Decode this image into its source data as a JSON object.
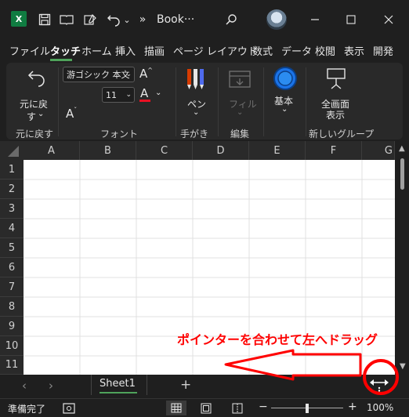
{
  "titlebar": {
    "app_badge": "X",
    "more": "»",
    "doc_title": "Book···"
  },
  "tabs": [
    "ファイル",
    "タッチ",
    "ホーム",
    "挿入",
    "描画",
    "ページ レイアウト",
    "数式",
    "データ",
    "校閲",
    "表示",
    "開発"
  ],
  "ribbon": {
    "undo": {
      "label_line1": "元に戻",
      "label_line2": "す",
      "group": "元に戻す"
    },
    "font": {
      "name": "游ゴシック 本文",
      "size": "11",
      "group": "フォント"
    },
    "pen": {
      "label": "ペン",
      "group": "手がき"
    },
    "fill": {
      "label": "フィル",
      "group": "編集"
    },
    "basic": {
      "label": "基本"
    },
    "fullscreen": {
      "label_line1": "全画面",
      "label_line2": "表示",
      "group": "新しいグループ"
    }
  },
  "sheet": {
    "columns": [
      "A",
      "B",
      "C",
      "D",
      "E",
      "F",
      "G"
    ],
    "rows": [
      "1",
      "2",
      "3",
      "4",
      "5",
      "6",
      "7",
      "8",
      "9",
      "10",
      "11"
    ]
  },
  "sheetbar": {
    "active_sheet": "Sheet1",
    "add": "+"
  },
  "status": {
    "ready": "準備完了",
    "zoom": "100%"
  },
  "annotation": {
    "text": "ポインターを合わせて左へドラッグ"
  },
  "colors": {
    "accent_green": "#4fa35b",
    "annotation_red": "#ff0000",
    "excel_green": "#107c41"
  }
}
